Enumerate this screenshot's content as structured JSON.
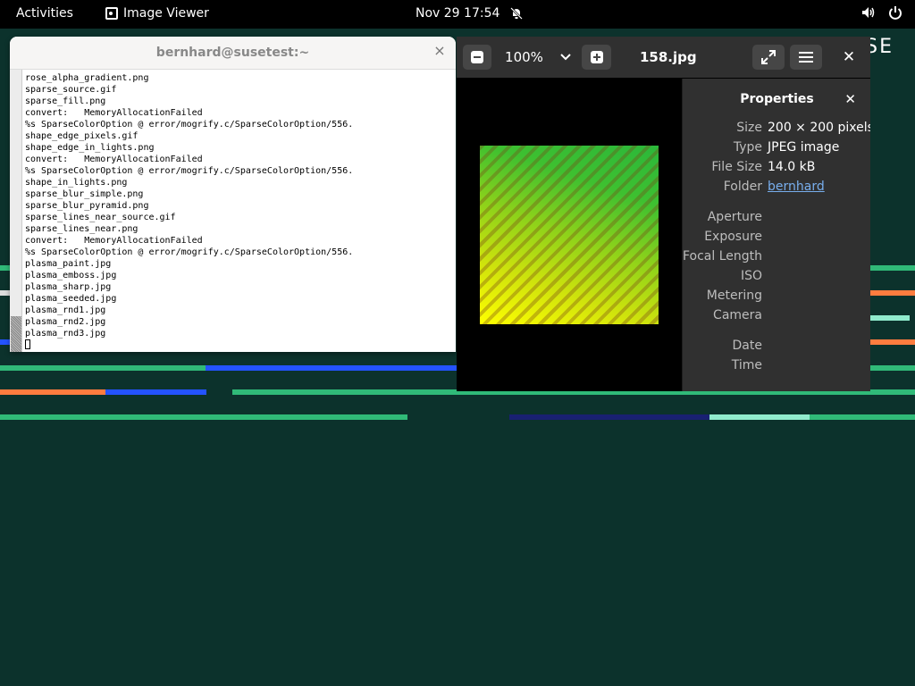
{
  "topbar": {
    "activities": "Activities",
    "app_name": "Image Viewer",
    "date": "Nov 29",
    "time": "17:54"
  },
  "desktop": {
    "brand": "SE"
  },
  "terminal": {
    "title": "bernhard@susetest:~",
    "lines": [
      "rose_alpha_gradient.png",
      "sparse_source.gif",
      "sparse_fill.png",
      "convert:   MemoryAllocationFailed",
      "%s SparseColorOption @ error/mogrify.c/SparseColorOption/556.",
      "shape_edge_pixels.gif",
      "shape_edge_in_lights.png",
      "convert:   MemoryAllocationFailed",
      "%s SparseColorOption @ error/mogrify.c/SparseColorOption/556.",
      "shape_in_lights.png",
      "sparse_blur_simple.png",
      "sparse_blur_pyramid.png",
      "sparse_lines_near_source.gif",
      "sparse_lines_near.png",
      "convert:   MemoryAllocationFailed",
      "%s SparseColorOption @ error/mogrify.c/SparseColorOption/556.",
      "plasma_paint.jpg",
      "plasma_emboss.jpg",
      "plasma_sharp.jpg",
      "plasma_seeded.jpg",
      "plasma_rnd1.jpg",
      "plasma_rnd2.jpg",
      "plasma_rnd3.jpg"
    ]
  },
  "viewer": {
    "zoom": "100%",
    "filename": "158.jpg",
    "properties": {
      "title": "Properties",
      "size_label": "Size",
      "size_value": "200 × 200 pixels",
      "type_label": "Type",
      "type_value": "JPEG image",
      "filesize_label": "File Size",
      "filesize_value": "14.0 kB",
      "folder_label": "Folder",
      "folder_value": "bernhard",
      "aperture_label": "Aperture",
      "exposure_label": "Exposure",
      "focal_label": "Focal Length",
      "iso_label": "ISO",
      "metering_label": "Metering",
      "camera_label": "Camera",
      "date_label": "Date",
      "time_label": "Time"
    }
  },
  "colors": {
    "desktop_bg": "#0c322c",
    "stripe_green": "#30ba78",
    "stripe_blue": "#2453ff",
    "stripe_orange": "#fe7c3f",
    "stripe_mint": "#90ebcd",
    "stripe_navy": "#192072"
  }
}
